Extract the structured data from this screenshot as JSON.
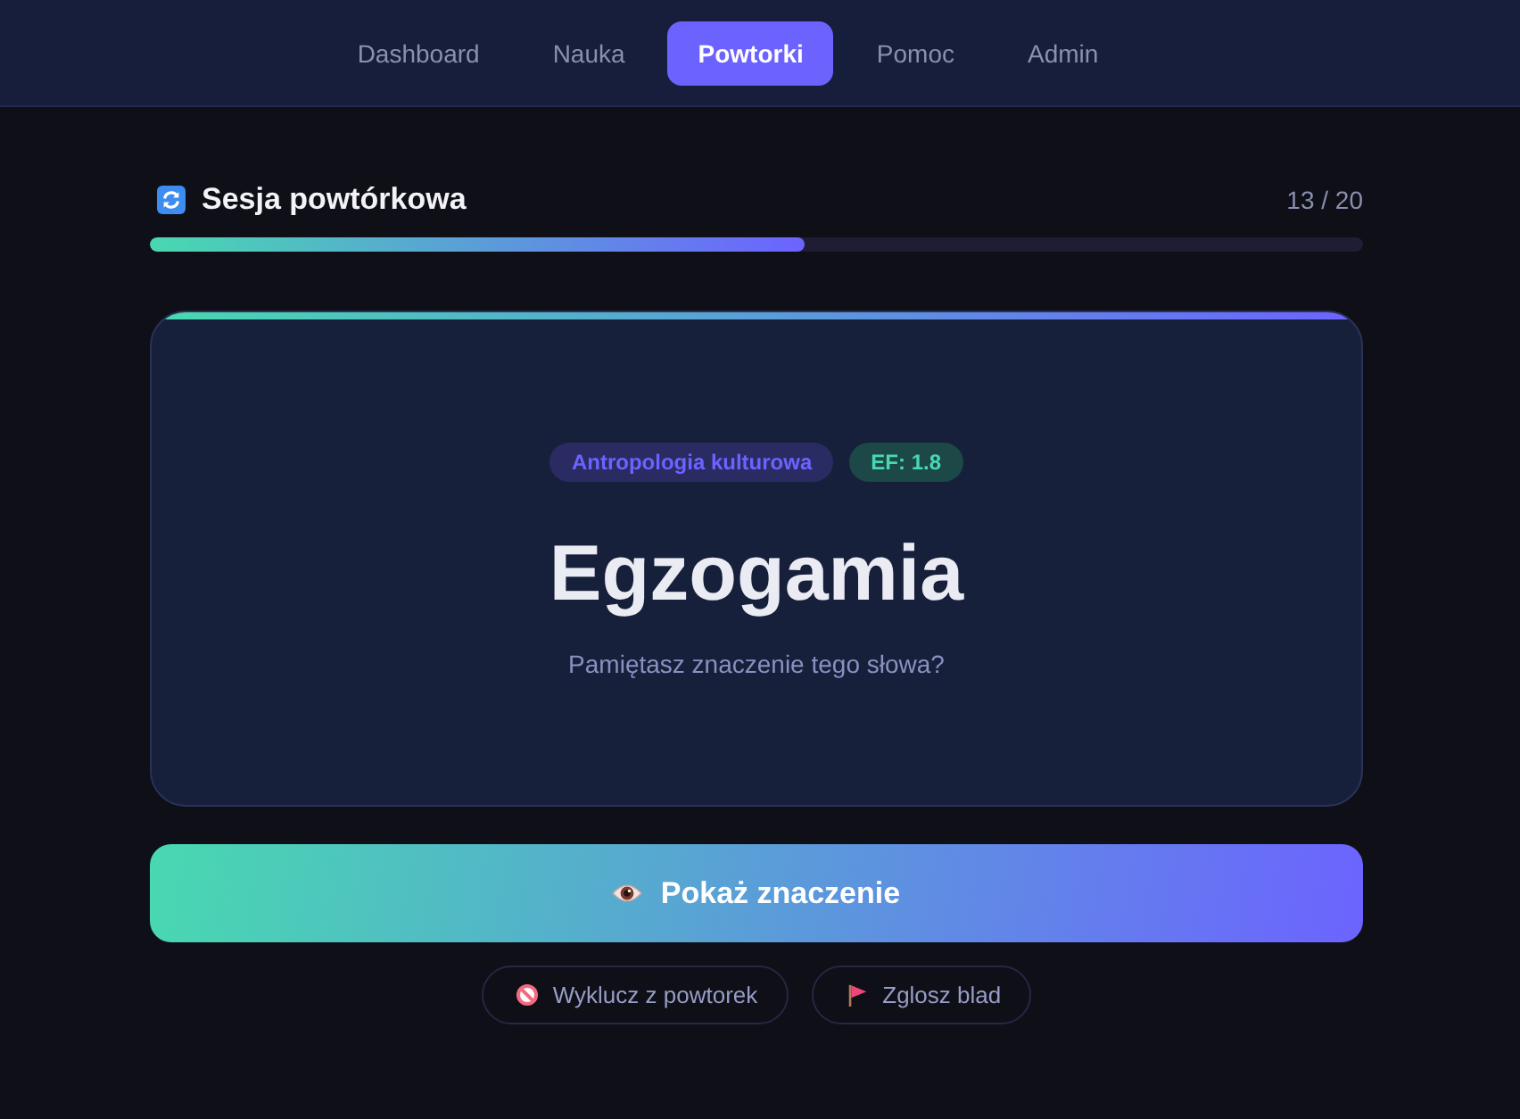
{
  "nav": {
    "tabs": [
      {
        "label": "Dashboard",
        "selected": false
      },
      {
        "label": "Nauka",
        "selected": false
      },
      {
        "label": "Powtorki",
        "selected": true
      },
      {
        "label": "Pomoc",
        "selected": false
      },
      {
        "label": "Admin",
        "selected": false
      }
    ]
  },
  "session": {
    "title": "Sesja powtórkowa",
    "counter": "13 / 20",
    "progress": {
      "level": 0.54
    }
  },
  "card": {
    "tags": [
      {
        "label": "Antropologia kulturowa",
        "kind": "category"
      },
      {
        "label": "EF: 1.8",
        "kind": "ef"
      }
    ],
    "word": "Egzogamia",
    "prompt": "Pamiętasz znaczenie tego słowa?"
  },
  "reveal_button": {
    "label": "Pokaż znaczenie"
  },
  "actions": [
    {
      "label": "Wyklucz z powtorek",
      "kind": "exclude"
    },
    {
      "label": "Zglosz blad",
      "kind": "report"
    }
  ]
}
